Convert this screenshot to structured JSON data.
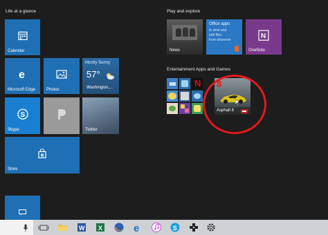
{
  "groups": {
    "life": "Life at a glance",
    "play": "Play and explore",
    "entertainment": "Entertainment Apps and Games"
  },
  "tiles": {
    "calendar": "Calendar",
    "edge": "Microsoft Edge",
    "photos": "Photos",
    "weather_status": "Mostly Sunny",
    "weather_temp": "57°",
    "weather_city": "Washington,...",
    "skype": "Skype",
    "twitter": "Twitter",
    "store": "Store",
    "news": "News",
    "office_line1": "Office apps",
    "office_line2": "to view and",
    "office_line3": "edit files",
    "office_line4": "from wherever",
    "onenote": "OneNote",
    "asphalt": "Asphalt 8",
    "asphalt_number": "8"
  },
  "colors": {
    "accent_blue": "#1f6fb4",
    "onenote_purple": "#7a3a8c",
    "highlight_red": "#e3191b",
    "taskbar": "#cfd1d4"
  },
  "taskbar_icons": [
    "microphone-icon",
    "task-view-icon",
    "file-explorer-icon",
    "word-icon",
    "excel-icon",
    "firefox-icon",
    "edge-icon",
    "itunes-icon",
    "skype-icon",
    "paint-icon",
    "ios-remote-icon",
    "settings-icon"
  ]
}
